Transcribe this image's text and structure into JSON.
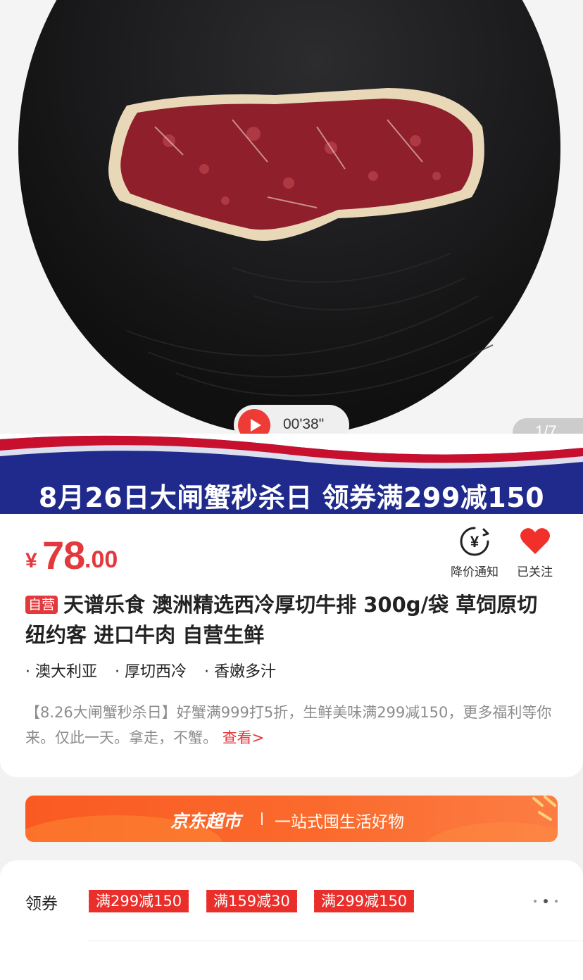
{
  "hero": {
    "video_duration": "00'38\"",
    "page_indicator": "1/7"
  },
  "banner": {
    "text": "8月26日大闸蟹秒杀日 领券满299减150"
  },
  "product": {
    "currency": "¥",
    "price_int": "78",
    "price_dec": ".00",
    "self_tag": "自营",
    "title": "天谱乐食  澳洲精选西冷厚切牛排  300g/袋  草饲原切 纽约客  进口牛肉 自营生鲜",
    "features": [
      "澳大利亚",
      "厚切西冷",
      "香嫩多汁"
    ],
    "promo_text": "【8.26大闸蟹秒杀日】好蟹满999打5折，生鲜美味满299减150，更多福利等你来。仅此一天。拿走，不蟹。",
    "promo_link": "查看>"
  },
  "actions": {
    "price_alert": "降价通知",
    "followed": "已关注"
  },
  "jd_strip": {
    "brand": "京东超市",
    "slogan": "一站式囤生活好物"
  },
  "coupons": {
    "label": "领券",
    "items": [
      "满299减150",
      "满159减30",
      "满299减150"
    ]
  },
  "colors": {
    "accent": "#e4393c",
    "banner_blue": "#1f2a8c",
    "strip_orange": "#fa5a22"
  }
}
